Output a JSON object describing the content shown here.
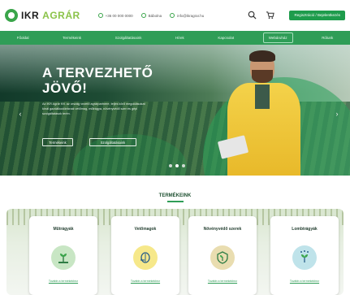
{
  "header": {
    "logo_ikr": "IKR",
    "logo_agrar": "AGRÁR",
    "contacts": [
      {
        "icon": "phone-icon",
        "text": "+36 00 000 0000"
      },
      {
        "icon": "location-icon",
        "text": "Bábolna"
      },
      {
        "icon": "mail-icon",
        "text": "info@ikragrar.hu"
      }
    ],
    "icons": [
      "search-icon",
      "cart-icon"
    ],
    "cta_label": "Regisztráció / Bejelentkezés"
  },
  "nav": {
    "items": [
      "Főoldal",
      "Termékeink",
      "Szolgáltatásaink",
      "Hírek",
      "Kapcsolat",
      "Webáruház",
      "Rólunk"
    ],
    "active_index": 5
  },
  "hero": {
    "title_line1": "A TERVEZHETŐ",
    "title_line2": "JÖVŐ!",
    "text": "Az IKR Agrár Kft. az ország vezető agrárpartnere, teljes körű megoldásokat kínál gazdálkodóinknak vetőmag, műtrágya, növényvédő szer és gépi szolgáltatások terén.",
    "buttons": [
      "Termékeink",
      "Szolgáltatásaink"
    ],
    "slide_count": 3,
    "active_slide": 1
  },
  "products": {
    "section_title": "TERMÉKEINK",
    "cards": [
      {
        "title": "Műtrágyák",
        "link": "Tovább a termékekhez",
        "icon": "fertilizer-plant-icon",
        "color": "#c8e6c4"
      },
      {
        "title": "Vetőmagok",
        "link": "Tovább a termékekhez",
        "icon": "seed-icon",
        "color": "#f6e88a"
      },
      {
        "title": "Növényvédő szerek",
        "link": "Tovább a termékekhez",
        "icon": "plant-protection-icon",
        "color": "#e9ddb0"
      },
      {
        "title": "Lombtrágyák",
        "link": "Tovább a termékekhez",
        "icon": "foliar-fertilizer-icon",
        "color": "#bfe3ea"
      }
    ]
  },
  "colors": {
    "brand_green": "#2f9d57",
    "cta_green": "#1e9c4c",
    "coat_yellow": "#f4d24a"
  }
}
